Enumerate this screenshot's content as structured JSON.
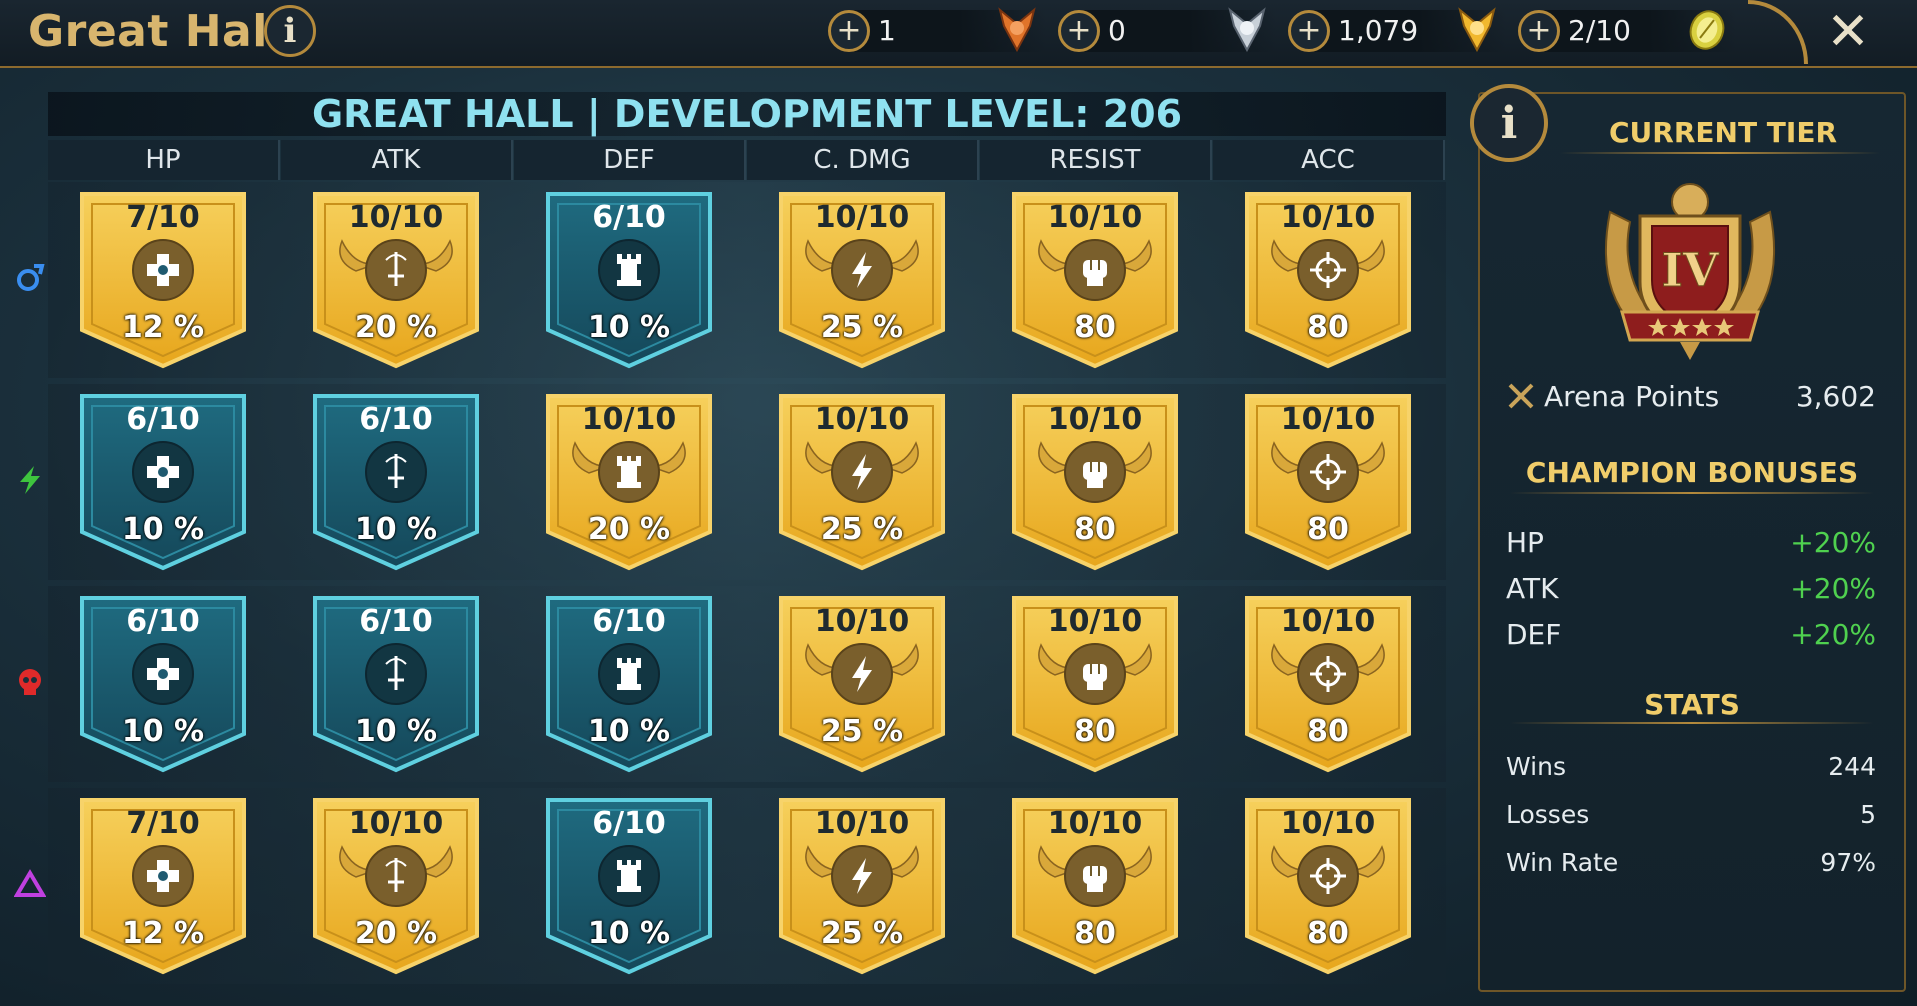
{
  "header": {
    "title": "Great Hall",
    "resources": [
      {
        "name": "bronze-medal",
        "value": "1",
        "color": "#e0742a"
      },
      {
        "name": "silver-medal",
        "value": "0",
        "color": "#c8d0d8"
      },
      {
        "name": "gold-medal",
        "value": "1,079",
        "color": "#f1b82e"
      },
      {
        "name": "arena-token",
        "value": "2/10",
        "color": "#e8e070"
      }
    ]
  },
  "grid": {
    "title": "GREAT HALL | DEVELOPMENT LEVEL: 206",
    "columns": [
      "HP",
      "ATK",
      "DEF",
      "C. DMG",
      "RESIST",
      "ACC"
    ],
    "column_icons": [
      "hp-cross-icon",
      "sword-icon",
      "tower-icon",
      "lightning-icon",
      "fist-icon",
      "crosshair-icon"
    ],
    "rows": [
      {
        "affinity": "magic",
        "icon": "magic-affinity-icon",
        "color": "#3a8ef0",
        "cells": [
          {
            "level": "7/10",
            "value": "12 %",
            "style": "gold"
          },
          {
            "level": "10/10",
            "value": "20 %",
            "style": "gold-wings"
          },
          {
            "level": "6/10",
            "value": "10 %",
            "style": "blue"
          },
          {
            "level": "10/10",
            "value": "25 %",
            "style": "gold-wings"
          },
          {
            "level": "10/10",
            "value": "80",
            "style": "gold-wings"
          },
          {
            "level": "10/10",
            "value": "80",
            "style": "gold-wings"
          }
        ]
      },
      {
        "affinity": "force",
        "icon": "force-affinity-icon",
        "color": "#3ec43e",
        "cells": [
          {
            "level": "6/10",
            "value": "10 %",
            "style": "blue"
          },
          {
            "level": "6/10",
            "value": "10 %",
            "style": "blue"
          },
          {
            "level": "10/10",
            "value": "20 %",
            "style": "gold-wings"
          },
          {
            "level": "10/10",
            "value": "25 %",
            "style": "gold-wings"
          },
          {
            "level": "10/10",
            "value": "80",
            "style": "gold-wings"
          },
          {
            "level": "10/10",
            "value": "80",
            "style": "gold-wings"
          }
        ]
      },
      {
        "affinity": "spirit",
        "icon": "spirit-affinity-icon",
        "color": "#e02a2a",
        "cells": [
          {
            "level": "6/10",
            "value": "10 %",
            "style": "blue"
          },
          {
            "level": "6/10",
            "value": "10 %",
            "style": "blue"
          },
          {
            "level": "6/10",
            "value": "10 %",
            "style": "blue"
          },
          {
            "level": "10/10",
            "value": "25 %",
            "style": "gold-wings"
          },
          {
            "level": "10/10",
            "value": "80",
            "style": "gold-wings"
          },
          {
            "level": "10/10",
            "value": "80",
            "style": "gold-wings"
          }
        ]
      },
      {
        "affinity": "void",
        "icon": "void-affinity-icon",
        "color": "#c040e0",
        "cells": [
          {
            "level": "7/10",
            "value": "12 %",
            "style": "gold"
          },
          {
            "level": "10/10",
            "value": "20 %",
            "style": "gold-wings"
          },
          {
            "level": "6/10",
            "value": "10 %",
            "style": "blue"
          },
          {
            "level": "10/10",
            "value": "25 %",
            "style": "gold-wings"
          },
          {
            "level": "10/10",
            "value": "80",
            "style": "gold-wings"
          },
          {
            "level": "10/10",
            "value": "80",
            "style": "gold-wings"
          }
        ]
      }
    ]
  },
  "sidebar": {
    "current_tier_label": "CURRENT TIER",
    "tier_numeral": "IV",
    "arena_points_label": "Arena Points",
    "arena_points_value": "3,602",
    "champion_bonuses_label": "CHAMPION BONUSES",
    "bonuses": [
      {
        "stat": "HP",
        "value": "+20%"
      },
      {
        "stat": "ATK",
        "value": "+20%"
      },
      {
        "stat": "DEF",
        "value": "+20%"
      }
    ],
    "stats_label": "STATS",
    "stats": [
      {
        "label": "Wins",
        "value": "244"
      },
      {
        "label": "Losses",
        "value": "5"
      },
      {
        "label": "Win Rate",
        "value": "97%"
      }
    ]
  }
}
